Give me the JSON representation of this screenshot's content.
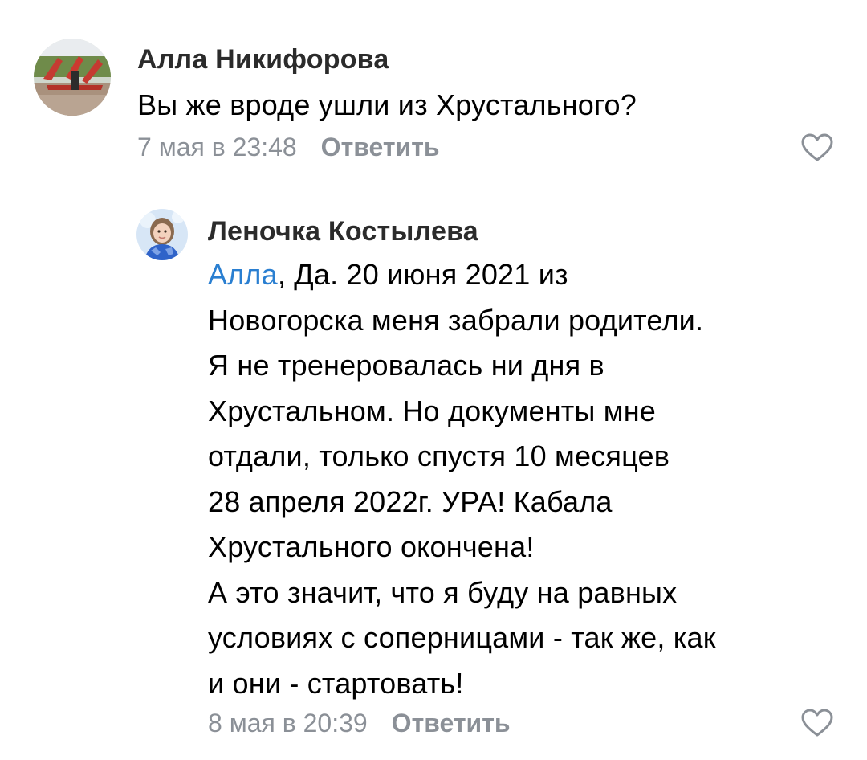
{
  "comments": [
    {
      "author": "Алла Никифорова",
      "text_lines": [
        "Вы же вроде ушли из Хрустального?"
      ],
      "time": "7 мая в 23:48",
      "reply_label": "Ответить",
      "icons": {
        "like": "heart-outline-icon"
      }
    },
    {
      "author": "Леночка Костылева",
      "mention": "Алла",
      "mention_suffix": ",  Да. 20 июня 2021 из",
      "text_lines": [
        "Новогорска меня забрали родители.",
        "Я не тренеровалась ни дня в",
        "Хрустальном.  Но  документы мне",
        "отдали, только спустя 10 месяцев",
        "28 апреля 2022г.  УРА!   Кабала",
        "Хрустального окончена!",
        "А это значит, что я буду на равных",
        "условиях с соперницами - так же, как",
        "и они - стартовать!"
      ],
      "time": "8 мая в 20:39",
      "reply_label": "Ответить",
      "icons": {
        "like": "heart-outline-icon"
      }
    }
  ],
  "colors": {
    "mention": "#2a7fd1",
    "meta": "#8b9097",
    "author": "#2b2b2b"
  }
}
